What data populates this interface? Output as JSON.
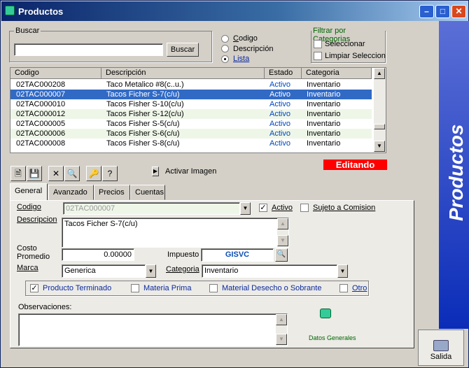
{
  "window": {
    "title": "Productos",
    "sidebar_text": "Productos",
    "salida_label": "Salida"
  },
  "search": {
    "group_label": "Buscar",
    "value": "",
    "button_label": "Buscar"
  },
  "radios": [
    {
      "label": "Codigo",
      "checked": false
    },
    {
      "label": "Descripción",
      "checked": false
    },
    {
      "label": "Lista",
      "checked": true
    }
  ],
  "filter": {
    "group_label": "Filtrar por Categorias",
    "select_label": "Seleccionar",
    "clear_label": "Limpiar Seleccion"
  },
  "table": {
    "columns": [
      "Codigo",
      "Descripción",
      "Estado",
      "Categoria"
    ],
    "rows": [
      {
        "codigo": "02TAC000208",
        "descripcion": "Taco Metalico #8(c..u.)",
        "estado": "Activo",
        "categoria": "Inventario"
      },
      {
        "codigo": "02TAC000007",
        "descripcion": "Tacos Ficher S-7(c/u)",
        "estado": "Activo",
        "categoria": "Inventario"
      },
      {
        "codigo": "02TAC000010",
        "descripcion": "Tacos Fisher S-10(c/u)",
        "estado": "Activo",
        "categoria": "Inventario"
      },
      {
        "codigo": "02TAC000012",
        "descripcion": "Tacos Fisher S-12(c/u)",
        "estado": "Activo",
        "categoria": "Inventario"
      },
      {
        "codigo": "02TAC000005",
        "descripcion": "Tacos Fisher S-5(c/u)",
        "estado": "Activo",
        "categoria": "Inventario"
      },
      {
        "codigo": "02TAC000006",
        "descripcion": "Tacos Fisher S-6(c/u)",
        "estado": "Activo",
        "categoria": "Inventario"
      },
      {
        "codigo": "02TAC000008",
        "descripcion": "Tacos Fisher S-8(c/u)",
        "estado": "Activo",
        "categoria": "Inventario"
      }
    ],
    "selected_index": 1
  },
  "toolbar": {
    "activar_imagen": "Activar Imagen",
    "status": "Editando"
  },
  "tabs": [
    "General",
    "Avanzado",
    "Precios",
    "Cuentas"
  ],
  "form": {
    "codigo_label": "Codigo",
    "codigo_value": "02TAC000007",
    "activo_label": "Activo",
    "sujeto_label": "Sujeto a Comision",
    "descripcion_label": "Descripcion",
    "descripcion_value": "Tacos Ficher S-7(c/u)",
    "costo_label_1": "Costo",
    "costo_label_2": "Promedio",
    "costo_value": "0.00000",
    "impuesto_label": "Impuesto",
    "impuesto_value": "GISVC",
    "marca_label": "Marca",
    "marca_value": "Generica",
    "categoria_label": "Categoria",
    "categoria_value": "Inventario",
    "producto_terminado": "Producto Terminado",
    "materia_prima": "Materia Prima",
    "material_desecho": "Material Desecho o Sobrante",
    "otro": "Otro",
    "observaciones_label": "Observaciones:",
    "observaciones_value": "",
    "datos_generales": "Datos Generales"
  }
}
